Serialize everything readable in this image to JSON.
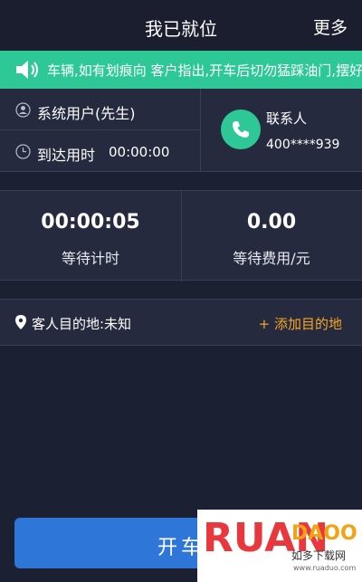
{
  "header": {
    "title": "我已就位",
    "more_label": "更多"
  },
  "notice": {
    "text": "车辆,如有划痕向 客户指出,开车后切勿猛踩油门,摆好"
  },
  "passenger": {
    "name": "系统用户(先生)",
    "arrival_label": "到达用时",
    "arrival_time": "00:00:00"
  },
  "contact": {
    "label": "联系人",
    "phone": "400****939"
  },
  "stats": {
    "wait_time": {
      "value": "00:00:05",
      "label": "等待计时"
    },
    "wait_fee": {
      "value": "0.00",
      "label": "等待费用/元"
    }
  },
  "destination": {
    "label": "客人目的地:未知",
    "add_label": "+ 添加目的地"
  },
  "start_button": {
    "label": "开车"
  },
  "watermark": {
    "logo": "RUAN",
    "brand": "DAOO",
    "cn": "如多下载网",
    "url": "www.ruaduo.com"
  },
  "colors": {
    "accent_green": "#2dc896",
    "accent_orange": "#f5a623",
    "button_blue": "#2e77d9"
  }
}
